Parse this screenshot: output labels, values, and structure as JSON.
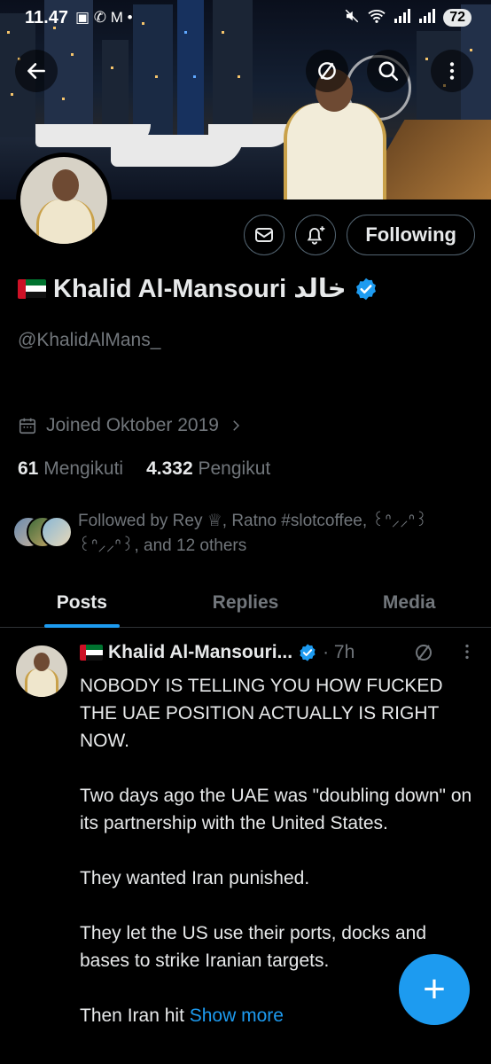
{
  "status_bar": {
    "time": "11.47",
    "notification_icons": "▣ ✆ M •",
    "battery": "72"
  },
  "header": {
    "back_icon": "arrow-left-icon",
    "grok_icon": "grok-slash-icon",
    "search_icon": "search-icon",
    "more_icon": "more-vertical-icon"
  },
  "profile": {
    "display_name": "Khalid Al-Mansouri خالد",
    "handle": "@KhalidAlMans_",
    "joined": "Joined Oktober 2019",
    "following_count": "61",
    "following_label": "Mengikuti",
    "followers_count": "4.332",
    "followers_label": "Pengikut",
    "followed_by": "Followed by Rey ♕, Ratno #slotcoffee, ꒰ᐢ⸝⸝ᐢ꒱ ꒰ᐢ⸝⸝ᐢ꒱, and 12 others",
    "following_button": "Following",
    "flag_colors": {
      "red": "#ce1126",
      "green": "#00732f",
      "white": "#ffffff",
      "black": "#000000"
    }
  },
  "tabs": [
    {
      "label": "Posts",
      "active": true
    },
    {
      "label": "Replies",
      "active": false
    },
    {
      "label": "Media",
      "active": false
    }
  ],
  "post": {
    "author": "Khalid Al-Mansouri...",
    "time": "· 7h",
    "text": "NOBODY IS TELLING YOU HOW FUCKED THE UAE POSITION ACTUALLY IS RIGHT NOW.\n\nTwo days ago the UAE was \"doubling down\" on its partnership with the United States.\n\nThey wanted Iran punished.\n\nThey let the US use their ports, docks and bases to strike Iranian targets.\n\nThen Iran hit ",
    "show_more": "Show more"
  },
  "fab": {
    "label": "+"
  },
  "colors": {
    "accent": "#1d9bf0",
    "muted": "#71767b",
    "text": "#e7e9ea",
    "background": "#000000",
    "border": "#2f3336"
  }
}
